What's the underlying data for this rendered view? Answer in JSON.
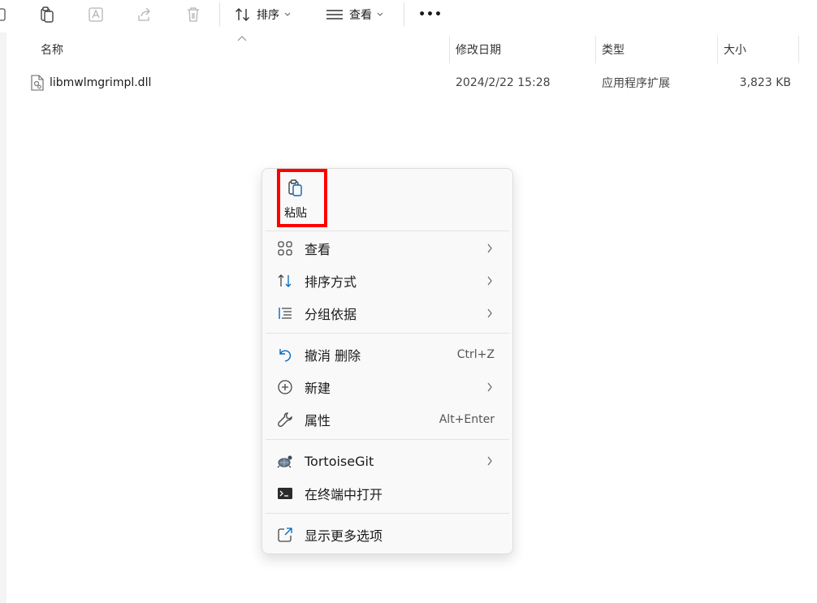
{
  "toolbar": {
    "sort_label": "排序",
    "view_label": "查看",
    "more_label": "•••"
  },
  "columns": {
    "name": "名称",
    "date": "修改日期",
    "type": "类型",
    "size": "大小"
  },
  "files": [
    {
      "name": "libmwlmgrimpl.dll",
      "date": "2024/2/22 15:28",
      "type": "应用程序扩展",
      "size": "3,823 KB"
    }
  ],
  "context_menu": {
    "paste_label": "粘贴",
    "items": [
      {
        "label": "查看",
        "icon": "grid-view-icon",
        "shortcut": "",
        "submenu": true
      },
      {
        "label": "排序方式",
        "icon": "sort-icon",
        "shortcut": "",
        "submenu": true
      },
      {
        "label": "分组依据",
        "icon": "group-by-icon",
        "shortcut": "",
        "submenu": true
      },
      {
        "label": "撤消 删除",
        "icon": "undo-icon",
        "shortcut": "Ctrl+Z",
        "submenu": false
      },
      {
        "label": "新建",
        "icon": "new-icon",
        "shortcut": "",
        "submenu": true
      },
      {
        "label": "属性",
        "icon": "wrench-icon",
        "shortcut": "Alt+Enter",
        "submenu": false
      },
      {
        "label": "TortoiseGit",
        "icon": "tortoisegit-icon",
        "shortcut": "",
        "submenu": true
      },
      {
        "label": "在终端中打开",
        "icon": "terminal-icon",
        "shortcut": "",
        "submenu": false
      },
      {
        "label": "显示更多选项",
        "icon": "more-options-icon",
        "shortcut": "",
        "submenu": false
      }
    ]
  },
  "colors": {
    "highlight_border": "#ff0000",
    "accent": "#0067c0"
  }
}
